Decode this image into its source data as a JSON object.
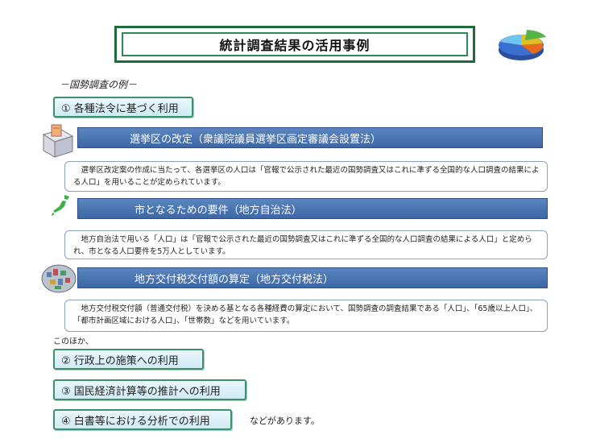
{
  "title": "統計調査結果の活用事例",
  "subtitle": "－国勢調査の例－",
  "section1": {
    "label": "① 各種法令に基づく利用"
  },
  "items": [
    {
      "heading": "選挙区の改定（衆議院議員選挙区画定審議会設置法）",
      "description": "　選挙区改定案の作成に当たって、各選挙区の人口は「官報で公示された最近の国勢調査又はこれに準ずる全国的な人口調査の結果による人口」を用いることが定められています。",
      "icon": "ballot-box-icon"
    },
    {
      "heading": "市となるための要件（地方自治法）",
      "description": "　地方自治法で用いる「人口」は「官報で公示された最近の国勢調査又はこれに準ずる全国的な人口調査の結果による人口」と定められ、市となる人口要件を5万人としています。",
      "icon": "japan-map-icon"
    },
    {
      "heading": "地方交付税交付額の算定（地方交付税法）",
      "description": "　地方交付税交付額（普通交付税）を決める基となる各種経費の算定において、国勢調査の調査結果である「人口」、「65歳以上人口」、「都市計画区域における人口」、「世帯数」などを用いています。",
      "icon": "city-icon"
    }
  ],
  "other_intro": "このほか、",
  "others": [
    {
      "label": "② 行政上の施策への利用"
    },
    {
      "label": "③ 国民経済計算等の推計への利用"
    },
    {
      "label": "④ 白書等における分析での利用"
    }
  ],
  "closing": "などがあります。",
  "colors": {
    "title_border": "#1e6b3a",
    "bar": "#3d67a5",
    "button_border": "#3f8f6a"
  }
}
